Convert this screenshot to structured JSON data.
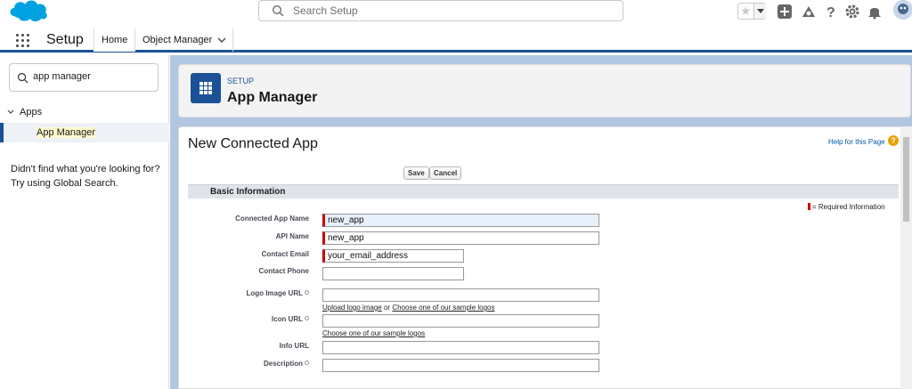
{
  "header": {
    "search_placeholder": "Search Setup"
  },
  "nav": {
    "app_name": "Setup",
    "tabs": [
      {
        "label": "Home"
      },
      {
        "label": "Object Manager"
      }
    ]
  },
  "sidebar": {
    "quick_find_value": "app manager",
    "tree_parent": "Apps",
    "tree_selected": "App Manager",
    "not_found_line1": "Didn't find what you're looking for?",
    "not_found_line2": "Try using Global Search."
  },
  "page_header": {
    "eyebrow": "SETUP",
    "title": "App Manager"
  },
  "form": {
    "title": "New Connected App",
    "help_link": "Help for this Page",
    "save_label": "Save",
    "cancel_label": "Cancel",
    "section_title": "Basic Information",
    "required_note": "= Required Information",
    "fields": {
      "connected_app_name": {
        "label": "Connected App Name",
        "value": "new_app"
      },
      "api_name": {
        "label": "API Name",
        "value": "new_app"
      },
      "contact_email": {
        "label": "Contact Email",
        "value": "your_email_address"
      },
      "contact_phone": {
        "label": "Contact Phone",
        "value": ""
      },
      "logo_image_url": {
        "label": "Logo Image URL",
        "value": ""
      },
      "icon_url": {
        "label": "Icon URL",
        "value": ""
      },
      "info_url": {
        "label": "Info URL",
        "value": ""
      },
      "description": {
        "label": "Description",
        "value": ""
      }
    },
    "logo_links": {
      "upload": "Upload logo image",
      "or": "or",
      "sample": "Choose one of our sample logos"
    },
    "icon_link": "Choose one of our sample logos"
  },
  "colors": {
    "brand_blue": "#1b5297",
    "salesforce_cloud": "#00a1e0",
    "required_red": "#cc0000"
  },
  "icons": [
    "salesforce-logo",
    "search-icon",
    "star-icon",
    "add-icon",
    "trailhead-icon",
    "help-icon",
    "gear-icon",
    "bell-icon",
    "avatar",
    "app-launcher-icon",
    "chevron-down-icon"
  ]
}
